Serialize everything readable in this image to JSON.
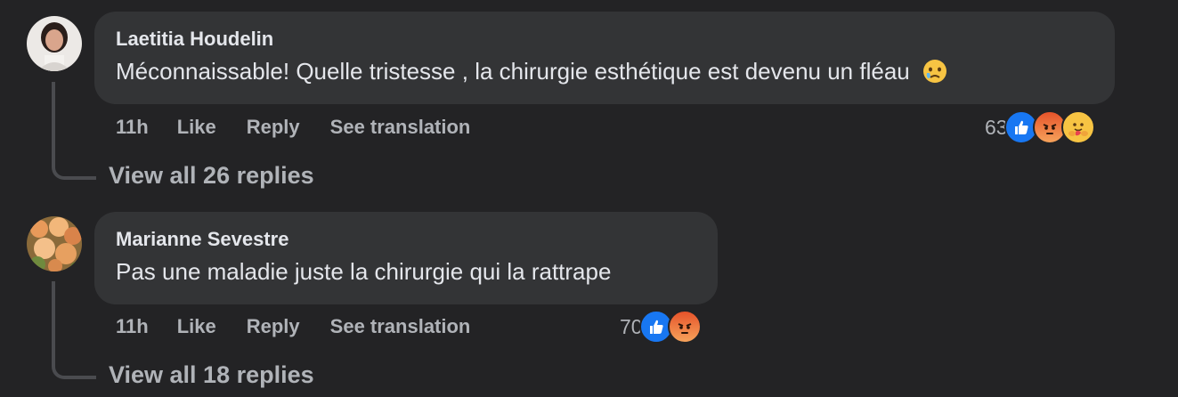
{
  "comments": [
    {
      "author": "Laetitia Houdelin",
      "text": "Méconnaissable! Quelle tristesse , la chirurgie esthétique est devenu un fléau",
      "time": "11h",
      "like_label": "Like",
      "reply_label": "Reply",
      "translate_label": "See translation",
      "reaction_count": "63",
      "reactions": [
        "like-icon",
        "angry-icon",
        "care-icon"
      ],
      "view_replies": "View all 26 replies"
    },
    {
      "author": "Marianne Sevestre",
      "text": "Pas une maladie juste la chirurgie qui la rattrape",
      "time": "11h",
      "like_label": "Like",
      "reply_label": "Reply",
      "translate_label": "See translation",
      "reaction_count": "70",
      "reactions": [
        "like-icon",
        "angry-icon"
      ],
      "view_replies": "View all 18 replies"
    }
  ],
  "colors": {
    "background": "#232325",
    "bubble": "#333436",
    "primary_text": "#e4e6eb",
    "secondary_text": "#b0b3b8",
    "like_blue": "#1877f2",
    "angry_top": "#e6532a",
    "angry_bottom": "#f6a35b"
  }
}
